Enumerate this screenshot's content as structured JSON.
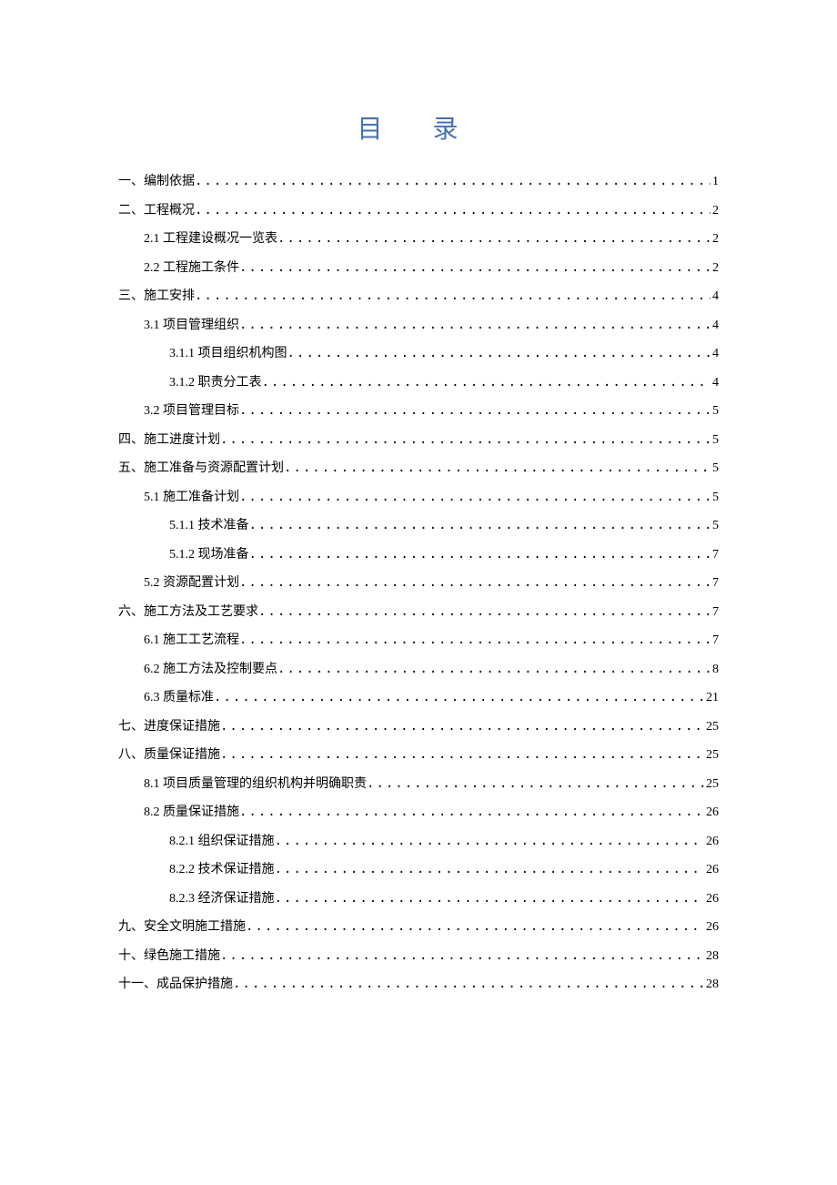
{
  "title": "目 录",
  "entries": [
    {
      "level": 0,
      "label": "一、编制依据",
      "page": "1"
    },
    {
      "level": 0,
      "label": "二、工程概况",
      "page": "2"
    },
    {
      "level": 1,
      "label": "2.1 工程建设概况一览表",
      "page": "2"
    },
    {
      "level": 1,
      "label": "2.2 工程施工条件",
      "page": "2"
    },
    {
      "level": 0,
      "label": "三、施工安排",
      "page": "4"
    },
    {
      "level": 1,
      "label": "3.1 项目管理组织",
      "page": "4"
    },
    {
      "level": 2,
      "label": "3.1.1 项目组织机构图",
      "page": "4"
    },
    {
      "level": 2,
      "label": "3.1.2 职责分工表",
      "page": "4"
    },
    {
      "level": 1,
      "label": "3.2 项目管理目标",
      "page": "5"
    },
    {
      "level": 0,
      "label": "四、施工进度计划",
      "page": "5"
    },
    {
      "level": 0,
      "label": "五、施工准备与资源配置计划",
      "page": "5"
    },
    {
      "level": 1,
      "label": "5.1 施工准备计划",
      "page": "5"
    },
    {
      "level": 2,
      "label": "5.1.1 技术准备",
      "page": "5"
    },
    {
      "level": 2,
      "label": "5.1.2 现场准备",
      "page": "7"
    },
    {
      "level": 1,
      "label": "5.2 资源配置计划",
      "page": "7"
    },
    {
      "level": 0,
      "label": "六、施工方法及工艺要求",
      "page": "7"
    },
    {
      "level": 1,
      "label": "6.1 施工工艺流程",
      "page": "7"
    },
    {
      "level": 1,
      "label": "6.2 施工方法及控制要点",
      "page": "8"
    },
    {
      "level": 1,
      "label": "6.3 质量标准",
      "page": "21"
    },
    {
      "level": 0,
      "label": "七、进度保证措施",
      "page": "25"
    },
    {
      "level": 0,
      "label": "八、质量保证措施",
      "page": "25"
    },
    {
      "level": 1,
      "label": "8.1 项目质量管理的组织机构并明确职责",
      "page": "25"
    },
    {
      "level": 1,
      "label": "8.2 质量保证措施",
      "page": "26"
    },
    {
      "level": 2,
      "label": "8.2.1 组织保证措施",
      "page": "26"
    },
    {
      "level": 2,
      "label": "8.2.2 技术保证措施",
      "page": "26"
    },
    {
      "level": 2,
      "label": "8.2.3 经济保证措施",
      "page": "26"
    },
    {
      "level": 0,
      "label": "九、安全文明施工措施",
      "page": "26"
    },
    {
      "level": 0,
      "label": "十、绿色施工措施",
      "page": "28"
    },
    {
      "level": 0,
      "label": "十一、成品保护措施",
      "page": "28"
    }
  ]
}
